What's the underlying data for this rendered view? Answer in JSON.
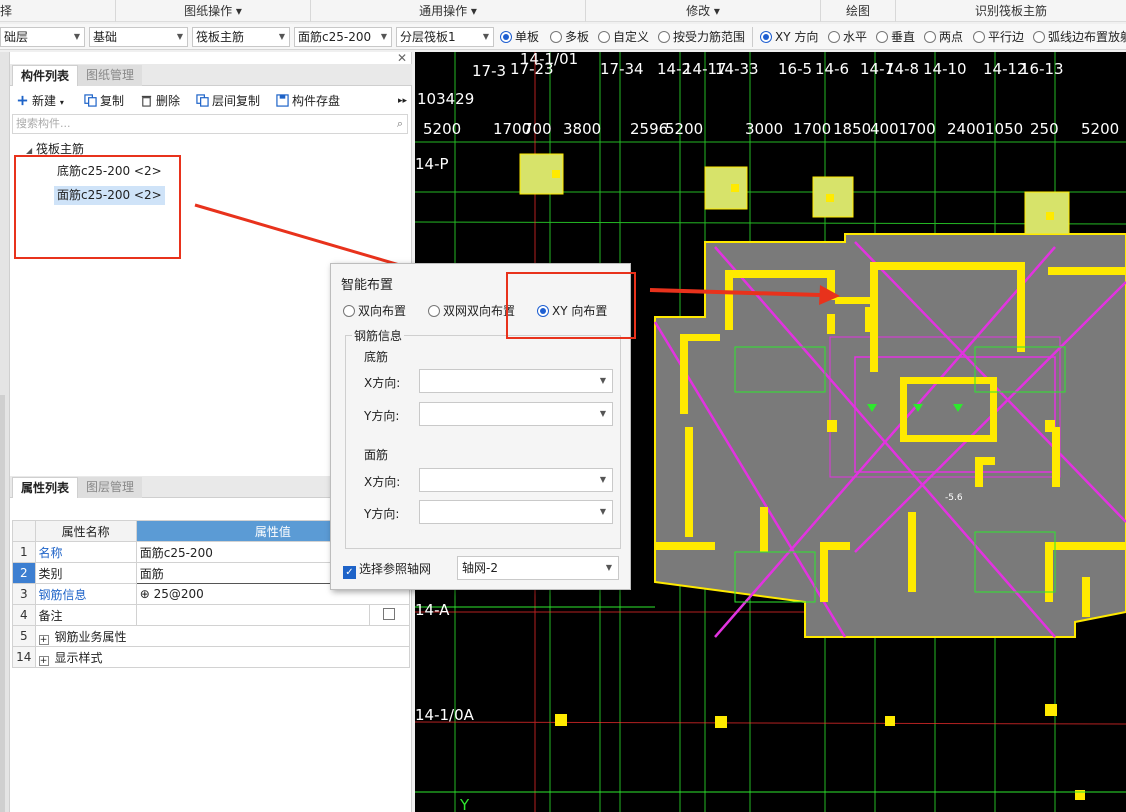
{
  "menu": {
    "groups": [
      "择",
      "图纸操作",
      "通用操作",
      "修改",
      "绘图",
      "识别筏板主筋"
    ]
  },
  "toolbar": {
    "floor": "础层",
    "category": "基础",
    "element_type": "筏板主筋",
    "element_name": "面筋c25-200",
    "layer": "分层筏板1",
    "board_options": [
      "单板",
      "多板",
      "自定义",
      "按受力筋范围"
    ],
    "direction_options": [
      "XY 方向",
      "水平",
      "垂直",
      "两点",
      "平行边",
      "弧线边布置放射"
    ]
  },
  "component_panel": {
    "tabs": [
      "构件列表",
      "图纸管理"
    ],
    "buttons": [
      "新建",
      "复制",
      "删除",
      "层间复制",
      "构件存盘"
    ],
    "search_placeholder": "搜索构件...",
    "tree_root": "筏板主筋",
    "items": [
      "底筋c25-200 <2>",
      "面筋c25-200 <2>"
    ]
  },
  "property_panel": {
    "tabs": [
      "属性列表",
      "图层管理"
    ],
    "headers": [
      "属性名称",
      "属性值"
    ],
    "rows": [
      {
        "num": "1",
        "name": "名称",
        "value": "面筋c25-200"
      },
      {
        "num": "2",
        "name": "类别",
        "value": "面筋"
      },
      {
        "num": "3",
        "name": "钢筋信息",
        "value": "⊕ 25@200"
      },
      {
        "num": "4",
        "name": "备注",
        "value": ""
      },
      {
        "num": "5",
        "name": "钢筋业务属性",
        "value": ""
      },
      {
        "num": "14",
        "name": "显示样式",
        "value": ""
      }
    ]
  },
  "dialog": {
    "title": "智能布置",
    "modes": [
      "双向布置",
      "双网双向布置",
      "XY 向布置"
    ],
    "selected_mode": "XY 向布置",
    "rebar_group": "钢筋信息",
    "bottom_label": "底筋",
    "top_label": "面筋",
    "x_label": "X方向:",
    "y_label": "Y方向:",
    "ref_axis_checkbox": "选择参照轴网",
    "ref_axis_value": "轴网-2"
  },
  "cad": {
    "top_labels": [
      "17-3",
      "17-23",
      "14-1/01",
      "17-34",
      "14-2",
      "14-17",
      "14-33",
      "16-5",
      "14-6",
      "14-7",
      "14-8",
      "14-10",
      "14-12",
      "16-13"
    ],
    "dims": [
      "103429",
      "5200",
      "1700",
      "700",
      "3800",
      "2596",
      "5200",
      "3000",
      "1700",
      "1850",
      "4001",
      "700",
      "2400",
      "1050",
      "250",
      "5200"
    ],
    "axis_rows": [
      "14-P",
      "14-A",
      "14-1/0A"
    ],
    "labels": [
      "-5.6",
      "Y"
    ]
  },
  "colors": {
    "accent": "#1e63c8",
    "highlight_red": "#e8321c",
    "cad_yellow": "#ffea00",
    "cad_magenta": "#e233e0",
    "cad_green": "#2ee82e",
    "slab_gray": "#7a7a7a"
  }
}
